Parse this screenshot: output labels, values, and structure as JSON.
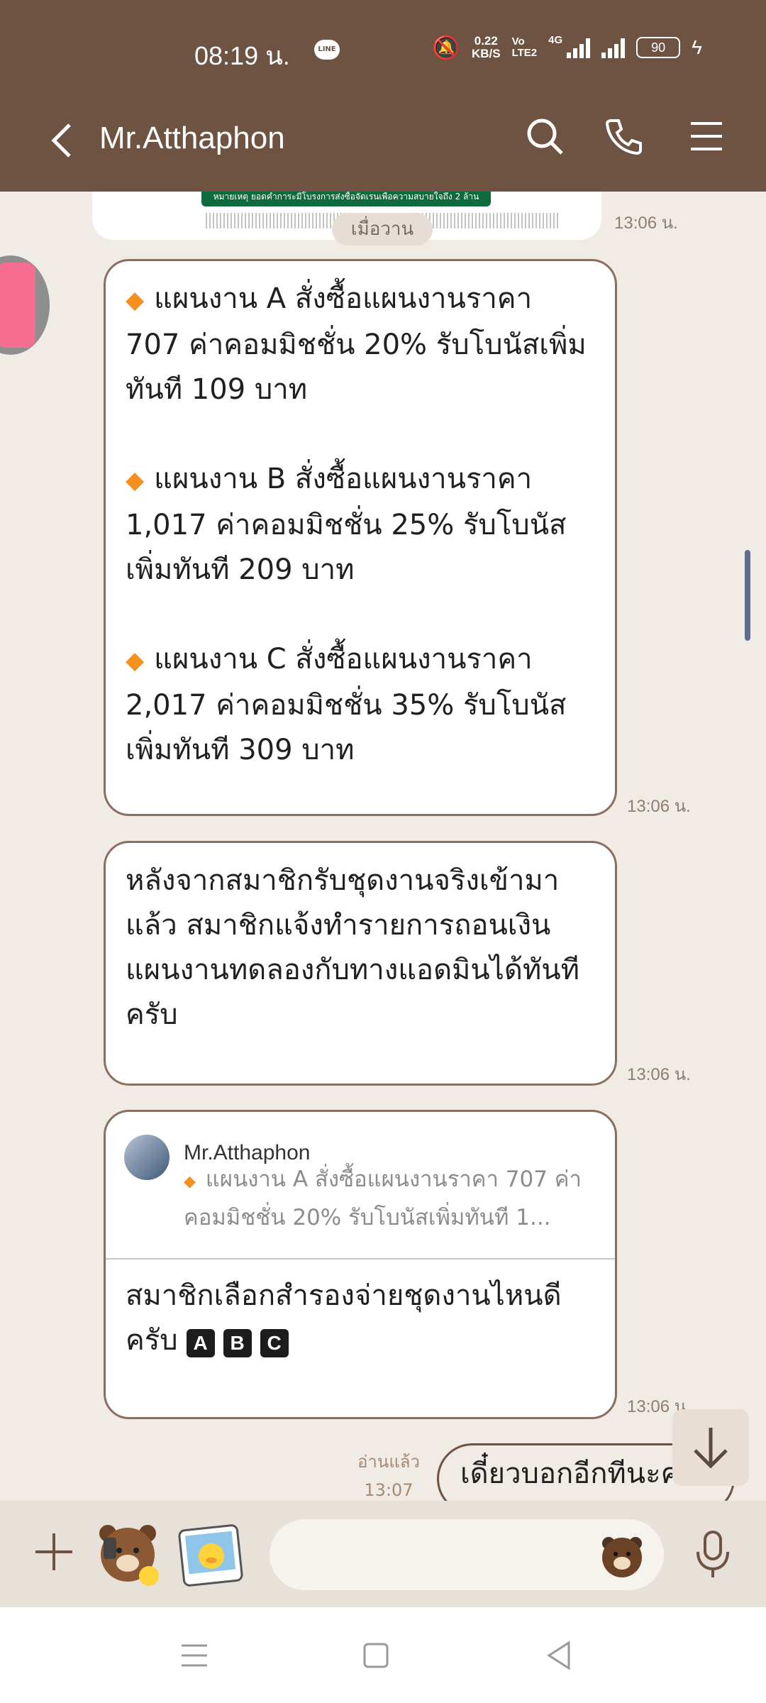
{
  "status": {
    "time": "08:19 น.",
    "line_badge": "LINE",
    "speed_value": "0.22",
    "speed_unit": "KB/S",
    "volte_top": "Vo",
    "volte_bottom": "LTE2",
    "network": "4G",
    "battery": "90"
  },
  "header": {
    "title": "Mr.Atthaphon"
  },
  "chat": {
    "day_label": "เมื่อวาน",
    "image_banner": "หมายเหตุ ยอดคำการะมีโบรงการส่งซื้อจัดเรนเพื่อความสบายใจถึง 2 ล้าน",
    "image_timestamp": "13:06 น.",
    "plans": [
      "แผนงาน A สั่งซื้อแผนงานราคา 707 ค่าคอมมิชชั่น 20% รับโบนัสเพิ่มทันที 109 บาท",
      "แผนงาน B สั่งซื้อแผนงานราคา 1,017 ค่าคอมมิชชั่น 25% รับโบนัสเพิ่มทันที 209 บาท",
      "แผนงาน C สั่งซื้อแผนงานราคา 2,017 ค่าคอมมิชชั่น 35% รับโบนัสเพิ่มทันที 309 บาท"
    ],
    "plans_timestamp": "13:06 น.",
    "withdraw_text": "หลังจากสมาชิกรับชุดงานจริงเข้ามาแล้ว สมาชิกแจ้งทำรายการถอนเงินแผนงานทดลองกับทางแอดมินได้ทันทีครับ",
    "withdraw_timestamp": "13:06 น.",
    "quote": {
      "name": "Mr.Atthaphon",
      "text": "แผนงาน A สั่งซื้อแผนงานราคา 707 ค่าคอมมิชชั่น 20% รับโบนัสเพิ่มทันที 1...",
      "message": "สมาชิกเลือกสำรองจ่ายชุดงานไหนดีครับ",
      "keys": [
        "A",
        "B",
        "C"
      ],
      "timestamp": "13:06 น."
    },
    "read_label": "อ่านแล้ว",
    "sent_timestamp": "13:07 น.",
    "sent_text": "เดี๋ยวบอกอีกทีนะคะ"
  },
  "input": {
    "placeholder": ""
  }
}
